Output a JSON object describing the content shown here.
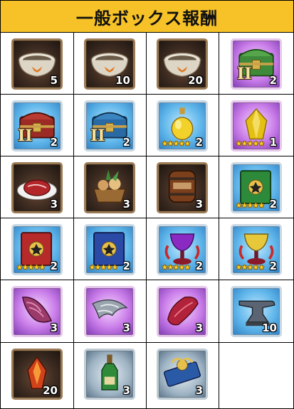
{
  "header": {
    "title": "一般ボックス報酬"
  },
  "rows": [
    [
      {
        "id": "pet-bowl",
        "icon": "pet-bowl-icon",
        "frame": "bronze",
        "qty": "5"
      },
      {
        "id": "pet-bowl",
        "icon": "pet-bowl-icon",
        "frame": "bronze",
        "qty": "10"
      },
      {
        "id": "pet-bowl",
        "icon": "pet-bowl-icon",
        "frame": "bronze",
        "qty": "20"
      },
      {
        "id": "green-chest-ii",
        "icon": "green-chest-icon",
        "frame": "purple",
        "qty": "2",
        "roman": "II"
      }
    ],
    [
      {
        "id": "red-chest-ii",
        "icon": "red-chest-icon",
        "frame": "blue",
        "qty": "2",
        "roman": "II"
      },
      {
        "id": "blue-chest-ii",
        "icon": "blue-chest-icon",
        "frame": "blue",
        "qty": "2",
        "roman": "II"
      },
      {
        "id": "golden-potion",
        "icon": "potion-bottle-icon",
        "frame": "blue",
        "qty": "2",
        "stars": "★★★★★"
      },
      {
        "id": "golden-gem",
        "icon": "gold-gem-icon",
        "frame": "purple",
        "qty": "1",
        "stars": "★★★★★"
      }
    ],
    [
      {
        "id": "meat",
        "icon": "meat-plate-icon",
        "frame": "bronze",
        "qty": "3"
      },
      {
        "id": "basket",
        "icon": "food-basket-icon",
        "frame": "bronze",
        "qty": "3"
      },
      {
        "id": "barrel",
        "icon": "barrel-icon",
        "frame": "bronze",
        "qty": "3"
      },
      {
        "id": "green-book",
        "icon": "green-book-icon",
        "frame": "blue",
        "qty": "2",
        "stars": "★★★★★"
      }
    ],
    [
      {
        "id": "red-book",
        "icon": "red-book-icon",
        "frame": "blue",
        "qty": "2",
        "stars": "★★★★★"
      },
      {
        "id": "blue-book",
        "icon": "blue-book-icon",
        "frame": "blue",
        "qty": "2",
        "stars": "★★★★★"
      },
      {
        "id": "purple-chalice",
        "icon": "purple-chalice-icon",
        "frame": "blue",
        "qty": "2",
        "stars": "★★★★★"
      },
      {
        "id": "gold-chalice",
        "icon": "gold-chalice-icon",
        "frame": "blue",
        "qty": "2",
        "stars": "★★★★★"
      }
    ],
    [
      {
        "id": "horn",
        "icon": "spiral-horn-icon",
        "frame": "purple",
        "qty": "3"
      },
      {
        "id": "wing",
        "icon": "gray-wing-icon",
        "frame": "purple",
        "qty": "3"
      },
      {
        "id": "claw",
        "icon": "red-claw-icon",
        "frame": "purple",
        "qty": "3"
      },
      {
        "id": "anvil",
        "icon": "anvil-icon",
        "frame": "blue",
        "qty": "10"
      }
    ],
    [
      {
        "id": "fire-shard",
        "icon": "fire-crystal-icon",
        "frame": "bronze",
        "qty": "20"
      },
      {
        "id": "bottle",
        "icon": "green-bottle-icon",
        "frame": "bluegray",
        "qty": "3"
      },
      {
        "id": "ticket",
        "icon": "ticket-icon",
        "frame": "bluegray",
        "qty": "3"
      }
    ]
  ],
  "colors": {
    "header_bg": "#f6c227",
    "stars": "#ffd21f"
  }
}
